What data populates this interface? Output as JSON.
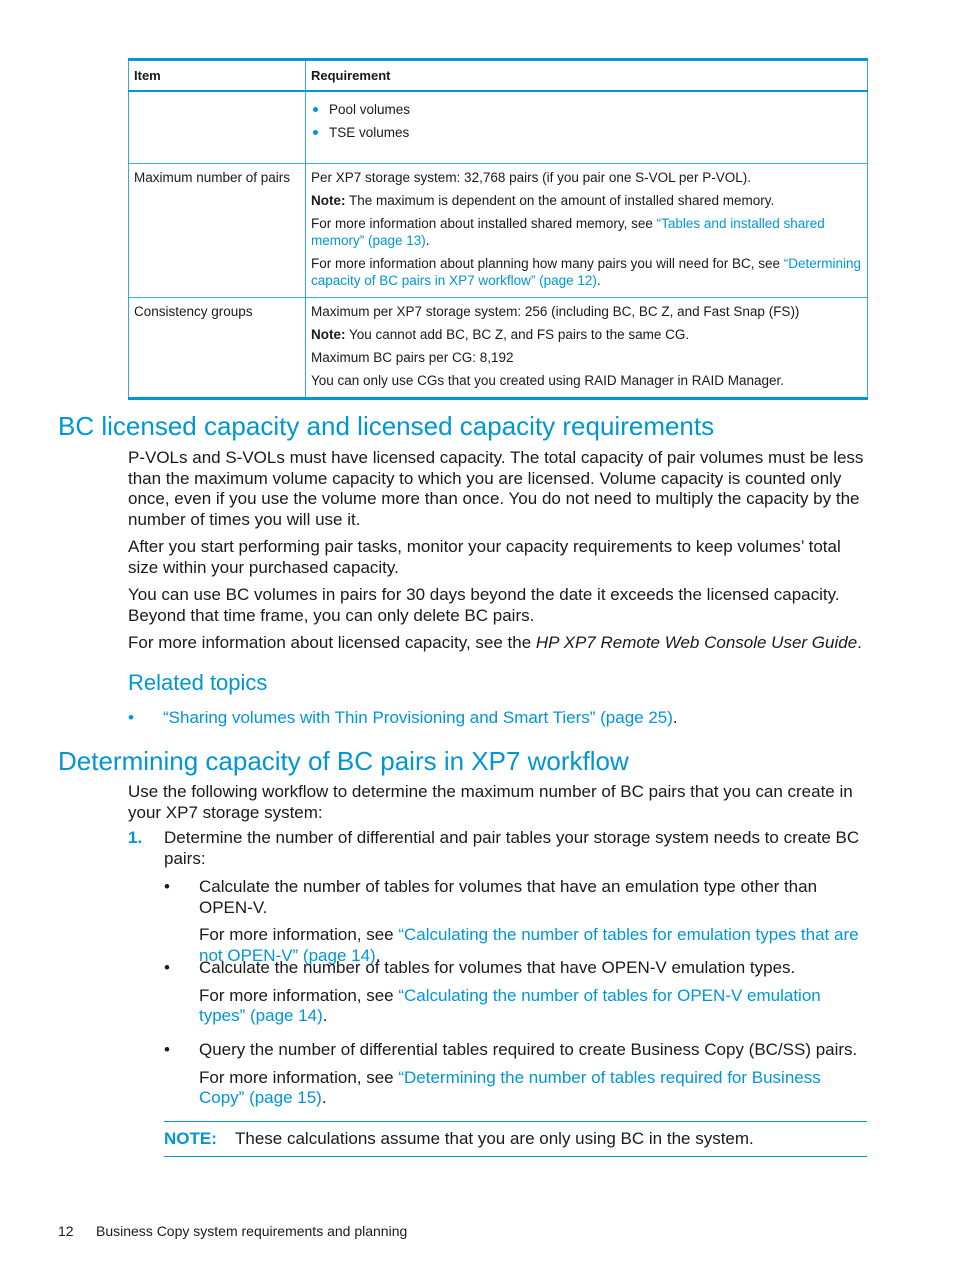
{
  "table": {
    "headers": [
      "Item",
      "Requirement"
    ],
    "rows": [
      {
        "item": "",
        "bullets": [
          "Pool volumes",
          "TSE volumes"
        ]
      },
      {
        "item": "Maximum number of pairs",
        "line1": "Per XP7 storage system: 32,768 pairs (if you pair one S-VOL per P-VOL).",
        "note_label": "Note:",
        "note_text": " The maximum is dependent on the amount of installed shared memory.",
        "para3_prefix": "For more information about installed shared memory, see ",
        "para3_link": "“Tables and installed shared memory” (page 13)",
        "para3_suffix": ".",
        "para4_prefix": "For more information about planning how many pairs you will need for BC, see ",
        "para4_link": "“Determining capacity of BC pairs in XP7 workflow” (page 12)",
        "para4_suffix": "."
      },
      {
        "item": "Consistency groups",
        "line1": "Maximum per XP7 storage system: 256 (including BC, BC Z, and Fast Snap (FS))",
        "note_label": "Note:",
        "note_text": " You cannot add BC, BC Z, and FS pairs to the same CG.",
        "line3": "Maximum BC pairs per CG: 8,192",
        "line4": "You can only use CGs that you created using RAID Manager in RAID Manager."
      }
    ]
  },
  "section1": {
    "heading": "BC licensed capacity and licensed capacity requirements",
    "p1": "P-VOLs and S-VOLs must have licensed capacity. The total capacity of pair volumes must be less than the maximum volume capacity to which you are licensed. Volume capacity is counted only once, even if you use the volume more than once. You do not need to multiply the capacity by the number of times you will use it.",
    "p2": "After you start performing pair tasks, monitor your capacity requirements to keep volumes’ total size within your purchased capacity.",
    "p3": "You can use BC volumes in pairs for 30 days beyond the date it exceeds the licensed capacity. Beyond that time frame, you can only delete BC pairs.",
    "p4_prefix": "For more information about licensed capacity, see the ",
    "p4_italic": "HP XP7 Remote Web Console User Guide",
    "p4_suffix": ".",
    "related_heading": "Related topics",
    "related_links": [
      {
        "text": "“Sharing volumes with Thin Provisioning and Smart Tiers” (page 25)",
        "suffix": "."
      }
    ]
  },
  "section2": {
    "heading": "Determining capacity of BC pairs in XP7 workflow",
    "intro": "Use the following workflow to determine the maximum number of BC pairs that you can create in your XP7 storage system:",
    "step1_num": "1.",
    "step1_text": "Determine the number of differential and pair tables your storage system needs to create BC pairs:",
    "substeps": [
      {
        "text": "Calculate the number of tables for volumes that have an emulation type other than OPEN-V.",
        "more_prefix": "For more information, see ",
        "more_link": "“Calculating the number of tables for emulation types that are not OPEN-V” (page 14)",
        "more_suffix": "."
      },
      {
        "text": "Calculate the number of tables for volumes that have OPEN-V emulation types.",
        "more_prefix": "For more information, see ",
        "more_link": "“Calculating the number of tables for OPEN-V emulation types” (page 14)",
        "more_suffix": "."
      },
      {
        "text": "Query the number of differential tables required to create Business Copy (BC/SS) pairs.",
        "more_prefix": "For more information, see ",
        "more_link": "“Determining the number of tables required for Business Copy” (page 15)",
        "more_suffix": "."
      }
    ],
    "note_label": "NOTE:",
    "note_text": "These calculations assume that you are only using BC in the system."
  },
  "footer": {
    "page_number": "12",
    "title": "Business Copy system requirements and planning"
  },
  "colors": {
    "accent": "#0096d6",
    "text": "#1a1a1a"
  }
}
